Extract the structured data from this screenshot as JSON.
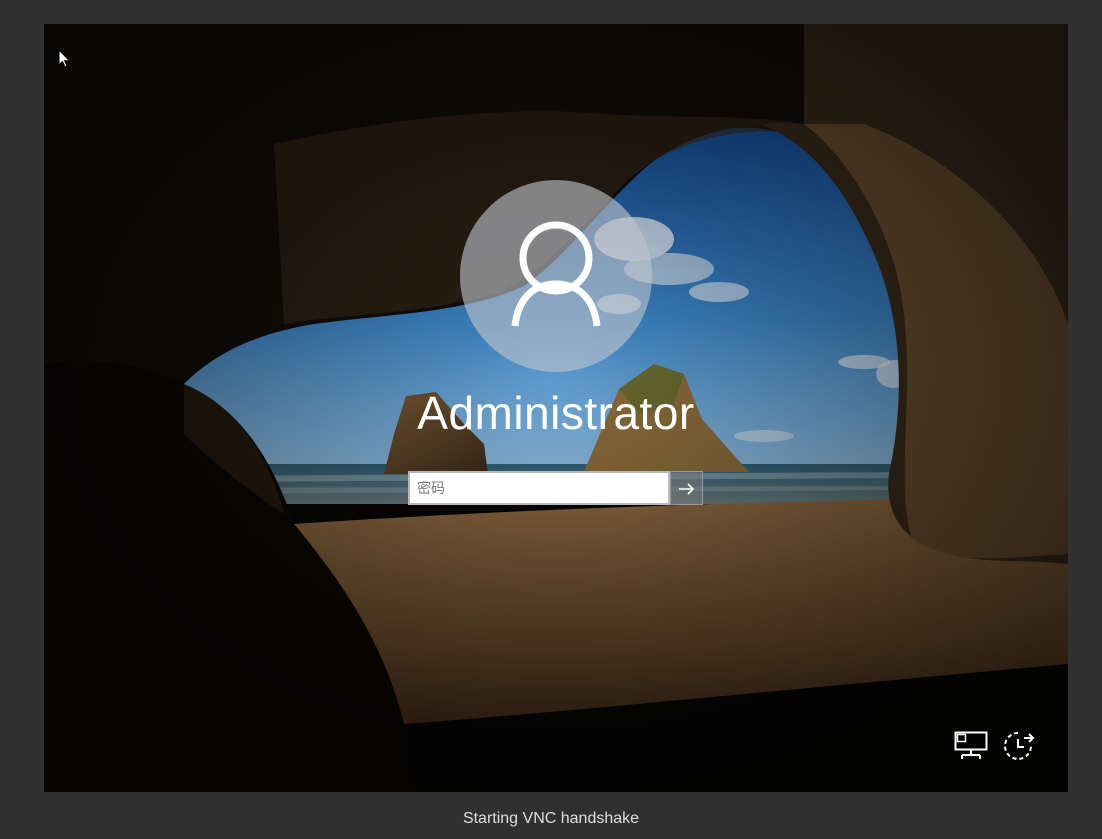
{
  "lock_screen": {
    "username": "Administrator",
    "password_placeholder": "密码",
    "submit_icon": "arrow-right-icon",
    "background": "sea-cave-beach"
  },
  "corner_buttons": [
    {
      "name": "network",
      "icon": "network-icon"
    },
    {
      "name": "ease-of-access",
      "icon": "ease-of-access-icon"
    }
  ],
  "status_bar": {
    "text": "Starting VNC handshake"
  },
  "colors": {
    "frame": "#313131",
    "status_text": "#dedede",
    "input_bg": "#ffffff"
  }
}
